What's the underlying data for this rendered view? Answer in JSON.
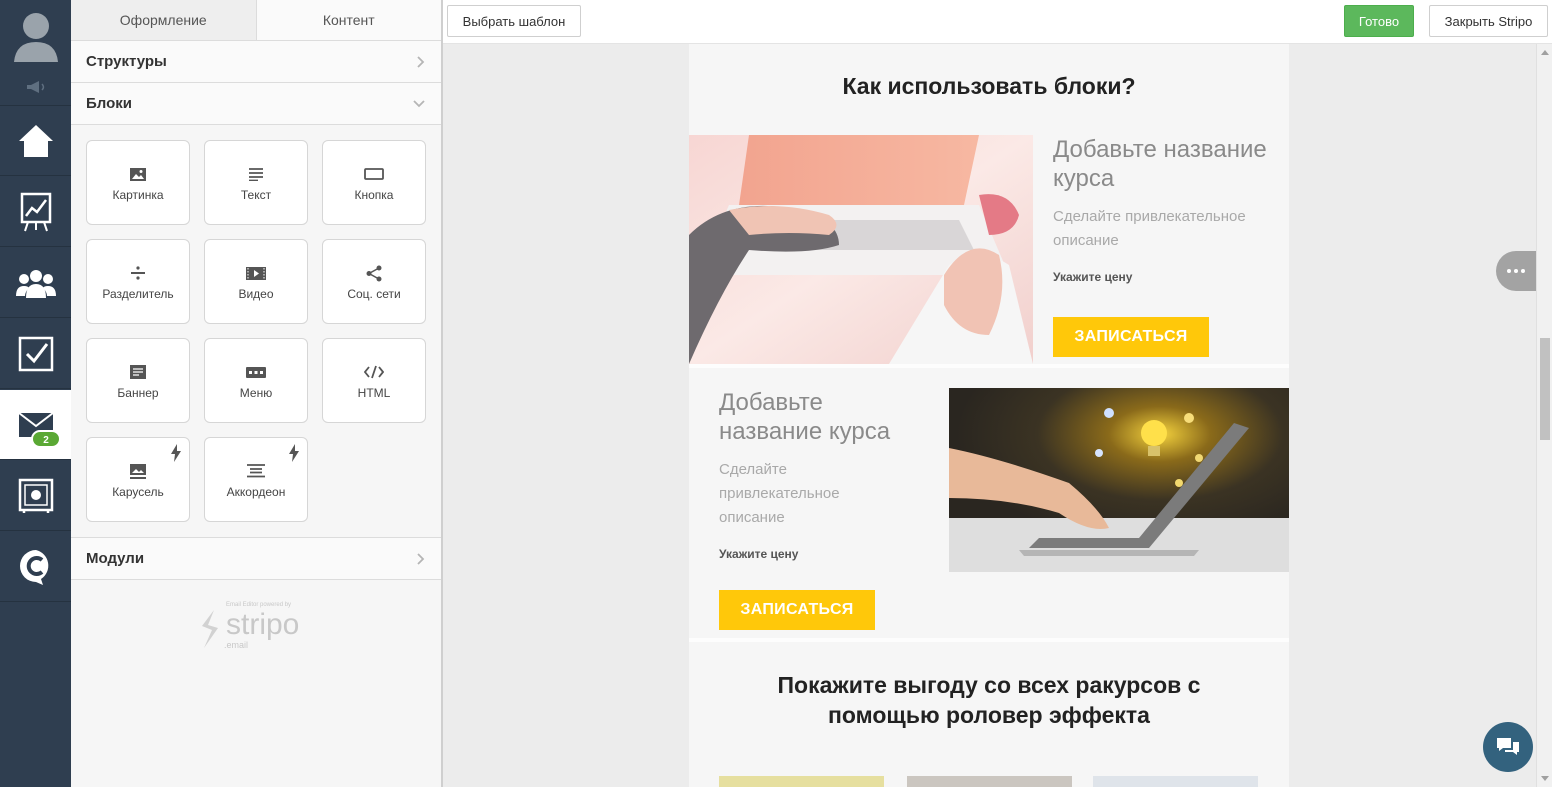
{
  "panel": {
    "tabs": [
      "Оформление",
      "Контент"
    ],
    "sections": {
      "structures": "Структуры",
      "blocks": "Блоки",
      "modules": "Модули"
    },
    "blocks": [
      {
        "label": "Картинка",
        "icon": "image-icon"
      },
      {
        "label": "Текст",
        "icon": "text-icon"
      },
      {
        "label": "Кнопка",
        "icon": "button-icon"
      },
      {
        "label": "Разделитель",
        "icon": "divider-icon"
      },
      {
        "label": "Видео",
        "icon": "video-icon"
      },
      {
        "label": "Соц. сети",
        "icon": "share-icon"
      },
      {
        "label": "Баннер",
        "icon": "banner-icon"
      },
      {
        "label": "Меню",
        "icon": "menu-icon"
      },
      {
        "label": "HTML",
        "icon": "code-icon"
      },
      {
        "label": "Карусель",
        "icon": "carousel-icon"
      },
      {
        "label": "Аккордеон",
        "icon": "accordion-icon"
      }
    ],
    "logo": {
      "small": "Email Editor powered by",
      "name": "stripo",
      "sub": ".email"
    }
  },
  "nav": {
    "badge": "2"
  },
  "toolbar": {
    "choose_template": "Выбрать шаблон",
    "done": "Готово",
    "close": "Закрыть Stripo"
  },
  "email": {
    "heading1": "Как использовать блоки?",
    "card1": {
      "title": "Добавьте название курса",
      "desc": "Сделайте привлекательное описание",
      "price": "Укажите цену",
      "button": "ЗАПИСАТЬСЯ"
    },
    "card2": {
      "title": "Добавьте название курса",
      "desc": "Сделайте привлекательное описание",
      "price": "Укажите цену",
      "button": "ЗАПИСАТЬСЯ"
    },
    "heading2": "Покажите выгоду со всех ракурсов с помощью роловер эффекта"
  },
  "colors": {
    "nav_bg": "#2f3e50",
    "accent_green": "#5cb85c",
    "cta_yellow": "#ffc80a",
    "chat_blue": "#33627e"
  }
}
